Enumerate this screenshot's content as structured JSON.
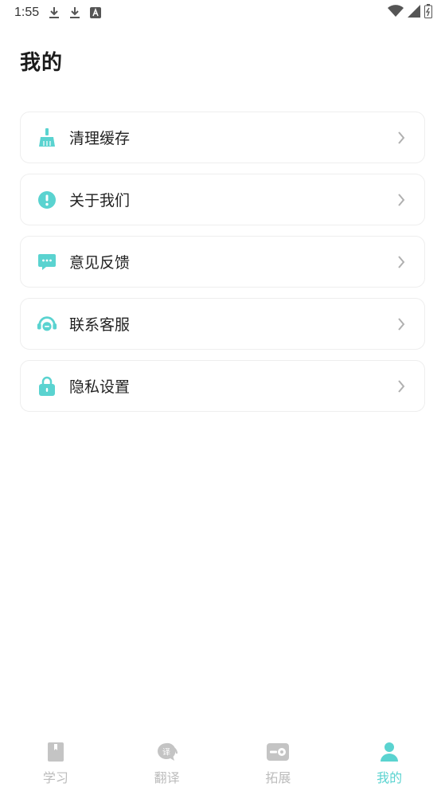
{
  "status_bar": {
    "time": "1:55",
    "notification_icons": [
      "download-icon",
      "download-icon",
      "text-a-icon"
    ],
    "system_icons": [
      "wifi-icon",
      "signal-icon",
      "battery-icon"
    ]
  },
  "page": {
    "title": "我的"
  },
  "menu": {
    "items": [
      {
        "label": "清理缓存",
        "icon": "broom-icon"
      },
      {
        "label": "关于我们",
        "icon": "info-icon"
      },
      {
        "label": "意见反馈",
        "icon": "feedback-chat-icon"
      },
      {
        "label": "联系客服",
        "icon": "headset-icon"
      },
      {
        "label": "隐私设置",
        "icon": "lock-icon"
      }
    ]
  },
  "bottom_nav": {
    "active_index": 3,
    "items": [
      {
        "label": "学习",
        "icon": "book-icon"
      },
      {
        "label": "翻译",
        "icon": "translate-icon"
      },
      {
        "label": "拓展",
        "icon": "extension-icon"
      },
      {
        "label": "我的",
        "icon": "user-icon"
      }
    ]
  },
  "colors": {
    "accent": "#5ad3d0",
    "inactive": "#c4c4c4",
    "text": "#222222",
    "border": "#eeeeee"
  }
}
